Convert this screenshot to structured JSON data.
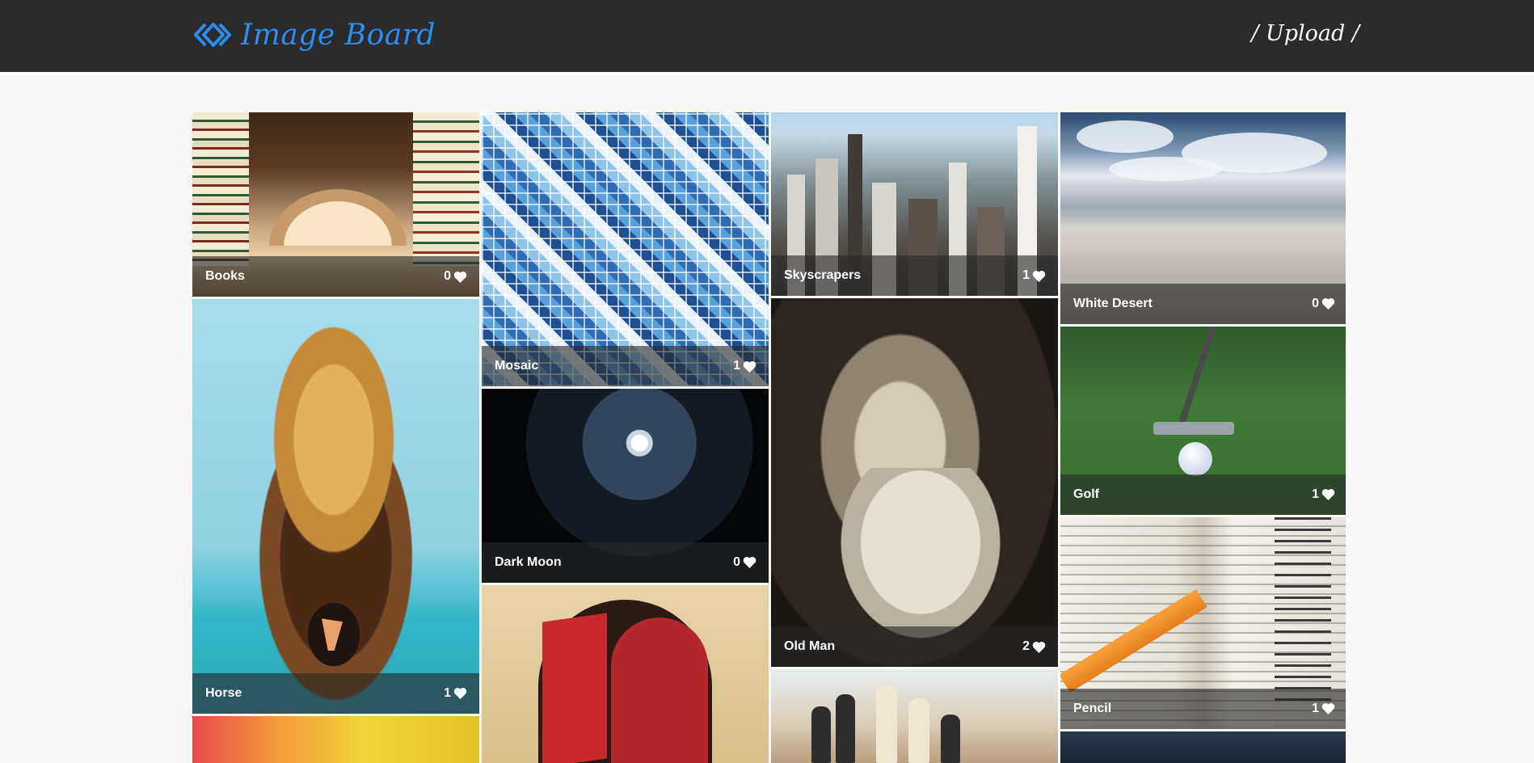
{
  "header": {
    "brand_title": "Image Board",
    "upload_label": "/ Upload /"
  },
  "colors": {
    "header_bg": "#2b2b2b",
    "brand": "#2d8cf0",
    "page_bg": "#f8f8f8"
  },
  "icons": {
    "brand": "diamond-logo-icon",
    "like": "heart-icon"
  },
  "images": [
    {
      "title": "Books",
      "likes": "0"
    },
    {
      "title": "Mosaic",
      "likes": "1"
    },
    {
      "title": "Skyscrapers",
      "likes": "1"
    },
    {
      "title": "White Desert",
      "likes": "0"
    },
    {
      "title": "Horse",
      "likes": "1"
    },
    {
      "title": "Dark Moon",
      "likes": "0"
    },
    {
      "title": "Old Man",
      "likes": "2"
    },
    {
      "title": "Golf",
      "likes": "1"
    },
    {
      "title": "Pencil",
      "likes": "1"
    }
  ]
}
